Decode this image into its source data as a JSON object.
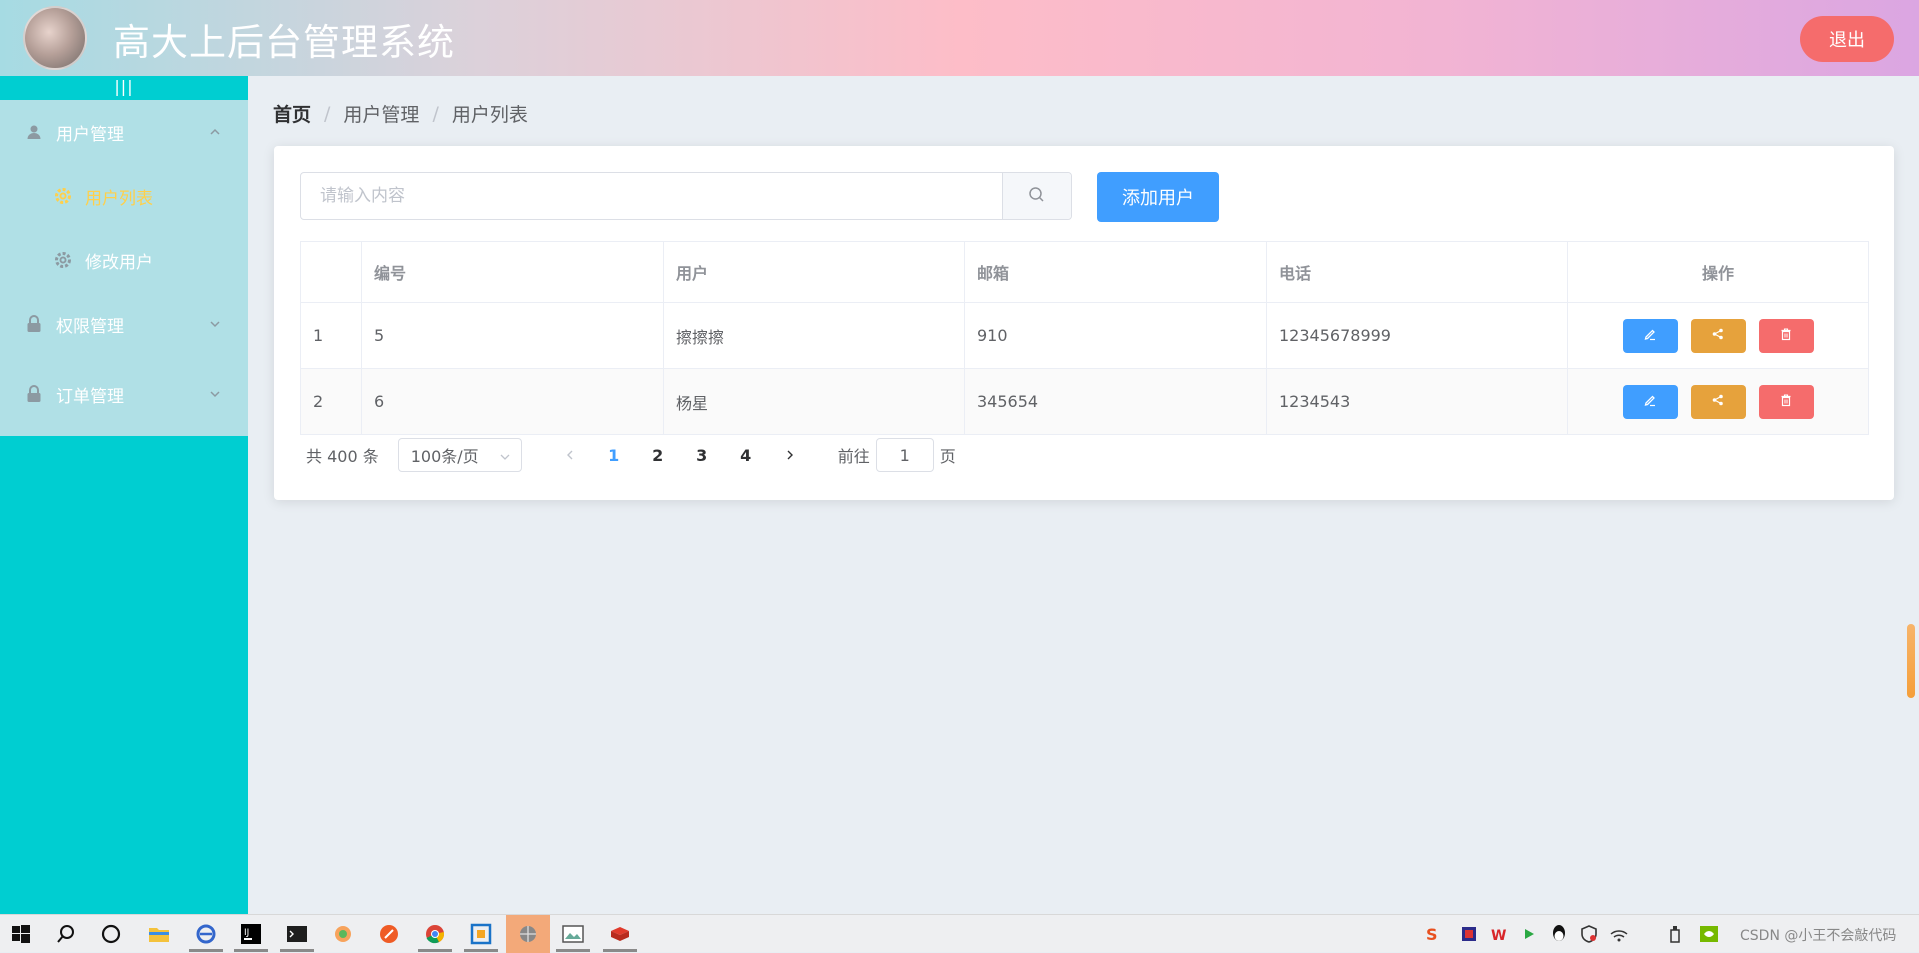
{
  "header": {
    "title": "高大上后台管理系统",
    "logout_label": "退出",
    "avatar_icon": "avatar-image"
  },
  "sidebar": {
    "toggle_label": "|||",
    "menu": [
      {
        "label": "用户管理",
        "icon": "user-icon",
        "expanded": true
      },
      {
        "label": "用户列表",
        "icon": "gear-icon",
        "active": true
      },
      {
        "label": "修改用户",
        "icon": "gear-icon"
      },
      {
        "label": "权限管理",
        "icon": "lock-icon",
        "expanded": false
      },
      {
        "label": "订单管理",
        "icon": "lock-icon",
        "expanded": false
      }
    ]
  },
  "breadcrumb": [
    "首页",
    "用户管理",
    "用户列表"
  ],
  "search": {
    "placeholder": "请输入内容",
    "value": ""
  },
  "add_button_label": "添加用户",
  "table": {
    "headers": [
      "",
      "编号",
      "用户",
      "邮箱",
      "电话",
      "操作"
    ],
    "rows": [
      {
        "index": "1",
        "id": "5",
        "user": "擦擦擦",
        "email": "910",
        "phone": "12345678999"
      },
      {
        "index": "2",
        "id": "6",
        "user": "杨星",
        "email": "345654",
        "phone": "1234543"
      }
    ]
  },
  "pagination": {
    "total_text": "共 400 条",
    "page_size": "100条/页",
    "pages": [
      "1",
      "2",
      "3",
      "4"
    ],
    "current_page": "1",
    "goto_prefix": "前往",
    "goto_value": "1",
    "goto_suffix": "页"
  },
  "taskbar": {
    "tray_text": "CSDN @小王不会敲代码"
  },
  "colors": {
    "primary": "#409eff",
    "warning": "#e6a23c",
    "danger": "#f56c6c",
    "sidebar": "#00ced1",
    "menu_bg": "#b0e0e6",
    "active_menu": "#ffd04b"
  }
}
